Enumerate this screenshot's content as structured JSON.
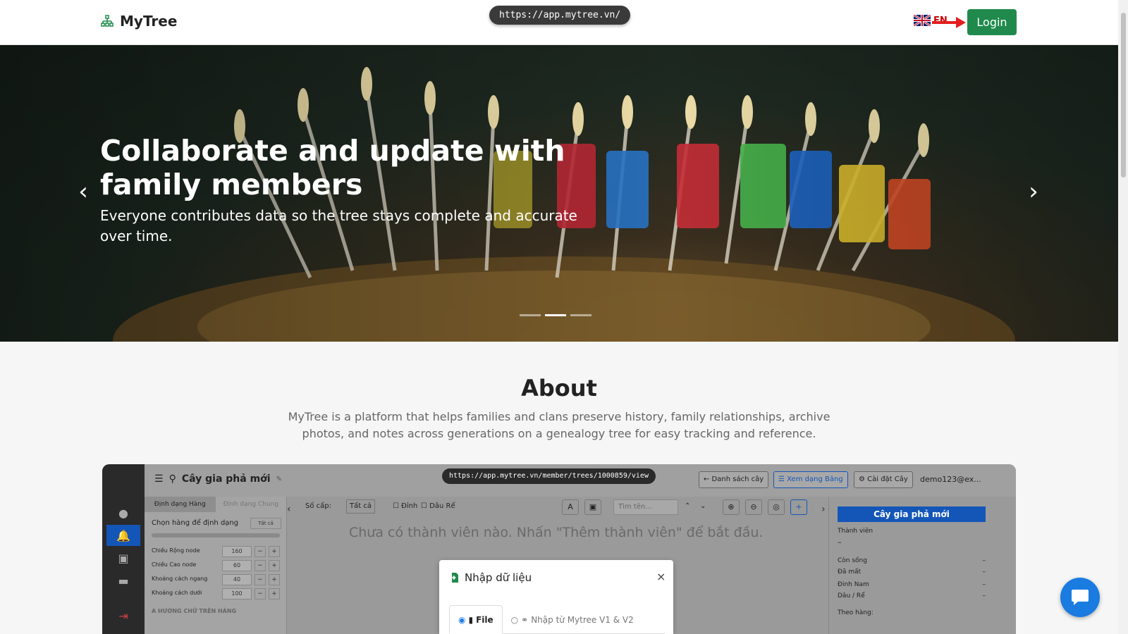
{
  "header": {
    "brand": "MyTree",
    "url": "https://app.mytree.vn/",
    "lang_code": "EN",
    "login_label": "Login"
  },
  "hero": {
    "title": "Collaborate and update with family members",
    "subtitle": "Everyone contributes data so the tree stays complete and accurate over time.",
    "slides": 3,
    "active_slide": 2
  },
  "about": {
    "title": "About",
    "text": "MyTree is a platform that helps families and clans preserve history, family relationships, archive photos, and notes across generations on a genealogy tree for easy tracking and reference."
  },
  "preview": {
    "tree_title": "Cây gia phả mới",
    "url": "https://app.mytree.vn/member/trees/1000859/view",
    "btn_list": "← Danh sách cây",
    "btn_table": "☰ Xem dạng Bảng",
    "btn_settings": "⚙ Cài đặt Cây",
    "user": "demo123@ex...",
    "tab_row": "Định dạng Hàng",
    "tab_common": "Định dạng Chung",
    "choose_row": "Chọn hàng để định dạng",
    "all_btn": "Tất cả",
    "fields": [
      {
        "label": "Chiều Rộng node",
        "value": "160"
      },
      {
        "label": "Chiều Cao node",
        "value": "60"
      },
      {
        "label": "Khoảng cách ngang",
        "value": "40"
      },
      {
        "label": "Khoảng cách dưới",
        "value": "100"
      }
    ],
    "text_direction": "A HƯỚNG CHỮ TRÊN HÀNG",
    "level_label": "Số cấp:",
    "level_value": "Tất cả",
    "chk_top": "Đỉnh",
    "chk_root": "Dâu Rể",
    "search_placeholder": "Tìm tên...",
    "empty_text": "Chưa có thành viên nào. Nhấn \"Thêm thành viên\" để bắt đầu.",
    "right_title": "Cây gia phả mới",
    "members_label": "Thành viên",
    "members_value": "–",
    "stats": [
      {
        "label": "Còn sống",
        "value": "–"
      },
      {
        "label": "Đã mất",
        "value": "–"
      },
      {
        "label": "Đinh Nam",
        "value": "–"
      },
      {
        "label": "Dâu / Rể",
        "value": "–"
      }
    ],
    "by_row": "Theo hàng:"
  },
  "modal": {
    "title": "Nhập dữ liệu",
    "close": "×",
    "tab_file": "File",
    "tab_import": "Nhập từ Mytree V1 & V2"
  },
  "colors": {
    "login": "#1f8a4c",
    "primary": "#1456b8",
    "chat": "#1a7be0"
  }
}
